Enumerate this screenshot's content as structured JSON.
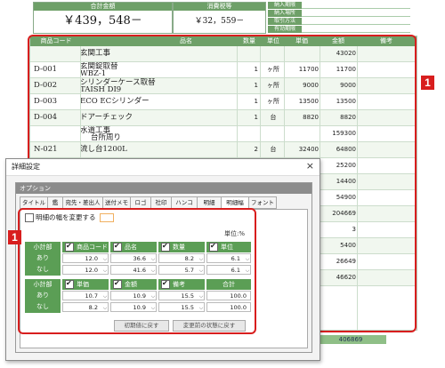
{
  "summary": {
    "total_label": "合計金額",
    "total_value": "￥439，548－",
    "tax_label": "消費税等",
    "tax_value": "￥32，559－",
    "delivery_labels": [
      "納入期限",
      "納入場所",
      "取引方法",
      "有効期限"
    ]
  },
  "table": {
    "headers": [
      "商品コード",
      "品名",
      "数量",
      "単位",
      "単価",
      "金額",
      "備考"
    ],
    "rows": [
      {
        "code": "",
        "name": "玄関工事",
        "name2": "",
        "qty": "",
        "unit": "",
        "price": "",
        "amount": "43020"
      },
      {
        "code": "D-001",
        "name": "玄関錠取替",
        "name2": "WBZ-1",
        "qty": "1",
        "unit": "ヶ所",
        "price": "11700",
        "amount": "11700"
      },
      {
        "code": "D-002",
        "name": "シリンダーケース取替",
        "name2": "TAISH DI9",
        "qty": "1",
        "unit": "ヶ所",
        "price": "9000",
        "amount": "9000"
      },
      {
        "code": "D-003",
        "name": "ECO ECシリンダー",
        "name2": "",
        "qty": "1",
        "unit": "ヶ所",
        "price": "13500",
        "amount": "13500"
      },
      {
        "code": "D-004",
        "name": "ドアーチェック",
        "name2": "",
        "qty": "1",
        "unit": "台",
        "price": "8820",
        "amount": "8820"
      },
      {
        "code": "",
        "name": "水道工事",
        "name2": "台所周り",
        "qty": "",
        "unit": "",
        "price": "",
        "amount": "159300"
      },
      {
        "code": "N-021",
        "name": "流し台1200L",
        "name2": "",
        "qty": "2",
        "unit": "台",
        "price": "32400",
        "amount": "64800"
      },
      {
        "code": "",
        "name": "",
        "name2": "",
        "qty": "",
        "unit": "",
        "price": "",
        "amount": "25200"
      },
      {
        "code": "",
        "name": "",
        "name2": "",
        "qty": "",
        "unit": "",
        "price": "",
        "amount": "14400"
      },
      {
        "code": "",
        "name": "",
        "name2": "",
        "qty": "",
        "unit": "",
        "price": "",
        "amount": "54900"
      },
      {
        "code": "",
        "name": "",
        "name2": "",
        "qty": "",
        "unit": "",
        "price": "",
        "amount": "204669"
      },
      {
        "code": "",
        "name": "",
        "name2": "",
        "qty": "",
        "unit": "",
        "price": "",
        "amount": "3"
      },
      {
        "code": "",
        "name": "",
        "name2": "",
        "qty": "",
        "unit": "",
        "price": "",
        "amount": "5400"
      },
      {
        "code": "",
        "name": "",
        "name2": "",
        "qty": "",
        "unit": "",
        "price": "",
        "amount": "26649"
      },
      {
        "code": "",
        "name": "",
        "name2": "",
        "qty": "",
        "unit": "",
        "price": "",
        "amount": "46620"
      }
    ],
    "footer_value": "406869"
  },
  "callout_number": "1",
  "dialog": {
    "title": "詳細設定",
    "close_glyph": "×",
    "group_title": "オプション",
    "tabs": [
      "タイトル",
      "鑑",
      "宛先・差出人",
      "送付メモ",
      "ロゴ",
      "社印",
      "ハンコ",
      "明細",
      "明細幅",
      "フォント"
    ],
    "active_tab": "明細幅",
    "change_width_checkbox": "明細の幅を変更する",
    "unit_note": "単位:%",
    "grid1": {
      "corner": "小計部",
      "columns": [
        "商品コード",
        "品名",
        "数量",
        "単位"
      ],
      "row_labels": [
        "あり",
        "なし"
      ],
      "values": [
        [
          "12.0",
          "36.6",
          "8.2",
          "6.1"
        ],
        [
          "12.0",
          "41.6",
          "5.7",
          "6.1"
        ]
      ]
    },
    "grid2": {
      "corner": "小計部",
      "columns": [
        "単価",
        "金額",
        "備考",
        "合計"
      ],
      "row_labels": [
        "あり",
        "なし"
      ],
      "values": [
        [
          "10.7",
          "10.9",
          "15.5",
          "100.0"
        ],
        [
          "8.2",
          "10.9",
          "15.5",
          "100.0"
        ]
      ]
    },
    "btn_reset": "初期値に戻す",
    "btn_revert": "変更前の状態に戻す"
  },
  "colors": {
    "accent_green": "#6ea068",
    "highlight_red": "#d81e1e"
  }
}
